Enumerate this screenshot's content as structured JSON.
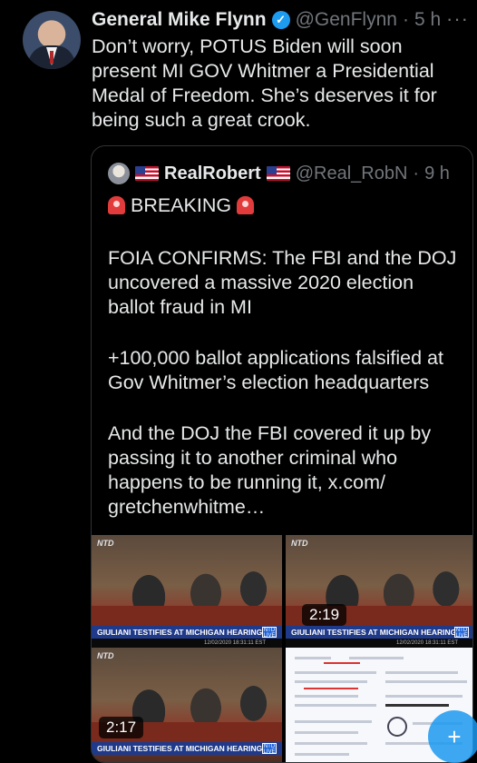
{
  "tweet": {
    "author_name": "General Mike Flynn",
    "verified_mark": "✓",
    "handle": "@GenFlynn",
    "separator": "·",
    "time": "5 h",
    "more": "···",
    "text": "Don’t worry, POTUS Biden will soon present MI GOV Whitmer a Presidential Medal of Freedom. She’s deserves it for being such a great crook."
  },
  "quote": {
    "author_name": "RealRobert",
    "handle": "@Real_RobN",
    "separator": "·",
    "time": "9 h",
    "breaking": "BREAKING",
    "paragraph1": "FOIA CONFIRMS: The FBI and the DOJ uncovered a massive 2020 election ballot fraud in MI",
    "paragraph2": "+100,000 ballot applications falsified at Gov Whitmer’s election headquarters",
    "paragraph3": "And the DOJ the FBI covered it up by passing it to another criminal who happens to be running it, x.com/ gretchenwhitme…"
  },
  "media": {
    "network": "NTD",
    "banner": "GIULIANI TESTIFIES AT MICHIGAN HEARING",
    "live": "NTD LIVE",
    "timestamp": "12/02/2020 18:31:11 EST",
    "durations": [
      "2:19",
      "2:17"
    ]
  },
  "icons": {
    "verified": "verified-badge-icon",
    "more": "more-options-icon",
    "siren": "police-light-icon",
    "flag": "us-flag-icon",
    "compose": "compose-plus-icon"
  },
  "colors": {
    "background": "#000000",
    "text": "#e7e9ea",
    "muted": "#71767b",
    "accent": "#1d9bf0",
    "border": "#2f3336"
  }
}
